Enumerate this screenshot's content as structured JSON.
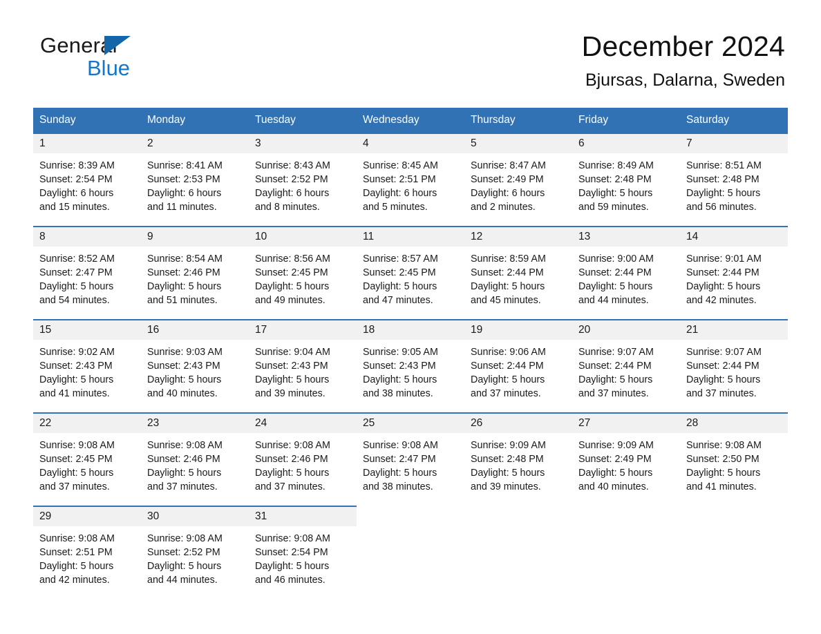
{
  "brand": {
    "line1": "General",
    "line2": "Blue",
    "triangle_icon": "triangle-icon",
    "color_black": "#1a1a1a",
    "color_blue": "#1577c7"
  },
  "header": {
    "title": "December 2024",
    "subtitle": "Bjursas, Dalarna, Sweden"
  },
  "theme": {
    "header_blue": "#3072b4",
    "daynum_gray": "#f1f1f1",
    "text": "#1a1a1a"
  },
  "weekday_headers": [
    "Sunday",
    "Monday",
    "Tuesday",
    "Wednesday",
    "Thursday",
    "Friday",
    "Saturday"
  ],
  "weeks": [
    [
      {
        "day": "1",
        "sunrise": "Sunrise: 8:39 AM",
        "sunset": "Sunset: 2:54 PM",
        "daylight1": "Daylight: 6 hours",
        "daylight2": "and 15 minutes."
      },
      {
        "day": "2",
        "sunrise": "Sunrise: 8:41 AM",
        "sunset": "Sunset: 2:53 PM",
        "daylight1": "Daylight: 6 hours",
        "daylight2": "and 11 minutes."
      },
      {
        "day": "3",
        "sunrise": "Sunrise: 8:43 AM",
        "sunset": "Sunset: 2:52 PM",
        "daylight1": "Daylight: 6 hours",
        "daylight2": "and 8 minutes."
      },
      {
        "day": "4",
        "sunrise": "Sunrise: 8:45 AM",
        "sunset": "Sunset: 2:51 PM",
        "daylight1": "Daylight: 6 hours",
        "daylight2": "and 5 minutes."
      },
      {
        "day": "5",
        "sunrise": "Sunrise: 8:47 AM",
        "sunset": "Sunset: 2:49 PM",
        "daylight1": "Daylight: 6 hours",
        "daylight2": "and 2 minutes."
      },
      {
        "day": "6",
        "sunrise": "Sunrise: 8:49 AM",
        "sunset": "Sunset: 2:48 PM",
        "daylight1": "Daylight: 5 hours",
        "daylight2": "and 59 minutes."
      },
      {
        "day": "7",
        "sunrise": "Sunrise: 8:51 AM",
        "sunset": "Sunset: 2:48 PM",
        "daylight1": "Daylight: 5 hours",
        "daylight2": "and 56 minutes."
      }
    ],
    [
      {
        "day": "8",
        "sunrise": "Sunrise: 8:52 AM",
        "sunset": "Sunset: 2:47 PM",
        "daylight1": "Daylight: 5 hours",
        "daylight2": "and 54 minutes."
      },
      {
        "day": "9",
        "sunrise": "Sunrise: 8:54 AM",
        "sunset": "Sunset: 2:46 PM",
        "daylight1": "Daylight: 5 hours",
        "daylight2": "and 51 minutes."
      },
      {
        "day": "10",
        "sunrise": "Sunrise: 8:56 AM",
        "sunset": "Sunset: 2:45 PM",
        "daylight1": "Daylight: 5 hours",
        "daylight2": "and 49 minutes."
      },
      {
        "day": "11",
        "sunrise": "Sunrise: 8:57 AM",
        "sunset": "Sunset: 2:45 PM",
        "daylight1": "Daylight: 5 hours",
        "daylight2": "and 47 minutes."
      },
      {
        "day": "12",
        "sunrise": "Sunrise: 8:59 AM",
        "sunset": "Sunset: 2:44 PM",
        "daylight1": "Daylight: 5 hours",
        "daylight2": "and 45 minutes."
      },
      {
        "day": "13",
        "sunrise": "Sunrise: 9:00 AM",
        "sunset": "Sunset: 2:44 PM",
        "daylight1": "Daylight: 5 hours",
        "daylight2": "and 44 minutes."
      },
      {
        "day": "14",
        "sunrise": "Sunrise: 9:01 AM",
        "sunset": "Sunset: 2:44 PM",
        "daylight1": "Daylight: 5 hours",
        "daylight2": "and 42 minutes."
      }
    ],
    [
      {
        "day": "15",
        "sunrise": "Sunrise: 9:02 AM",
        "sunset": "Sunset: 2:43 PM",
        "daylight1": "Daylight: 5 hours",
        "daylight2": "and 41 minutes."
      },
      {
        "day": "16",
        "sunrise": "Sunrise: 9:03 AM",
        "sunset": "Sunset: 2:43 PM",
        "daylight1": "Daylight: 5 hours",
        "daylight2": "and 40 minutes."
      },
      {
        "day": "17",
        "sunrise": "Sunrise: 9:04 AM",
        "sunset": "Sunset: 2:43 PM",
        "daylight1": "Daylight: 5 hours",
        "daylight2": "and 39 minutes."
      },
      {
        "day": "18",
        "sunrise": "Sunrise: 9:05 AM",
        "sunset": "Sunset: 2:43 PM",
        "daylight1": "Daylight: 5 hours",
        "daylight2": "and 38 minutes."
      },
      {
        "day": "19",
        "sunrise": "Sunrise: 9:06 AM",
        "sunset": "Sunset: 2:44 PM",
        "daylight1": "Daylight: 5 hours",
        "daylight2": "and 37 minutes."
      },
      {
        "day": "20",
        "sunrise": "Sunrise: 9:07 AM",
        "sunset": "Sunset: 2:44 PM",
        "daylight1": "Daylight: 5 hours",
        "daylight2": "and 37 minutes."
      },
      {
        "day": "21",
        "sunrise": "Sunrise: 9:07 AM",
        "sunset": "Sunset: 2:44 PM",
        "daylight1": "Daylight: 5 hours",
        "daylight2": "and 37 minutes."
      }
    ],
    [
      {
        "day": "22",
        "sunrise": "Sunrise: 9:08 AM",
        "sunset": "Sunset: 2:45 PM",
        "daylight1": "Daylight: 5 hours",
        "daylight2": "and 37 minutes."
      },
      {
        "day": "23",
        "sunrise": "Sunrise: 9:08 AM",
        "sunset": "Sunset: 2:46 PM",
        "daylight1": "Daylight: 5 hours",
        "daylight2": "and 37 minutes."
      },
      {
        "day": "24",
        "sunrise": "Sunrise: 9:08 AM",
        "sunset": "Sunset: 2:46 PM",
        "daylight1": "Daylight: 5 hours",
        "daylight2": "and 37 minutes."
      },
      {
        "day": "25",
        "sunrise": "Sunrise: 9:08 AM",
        "sunset": "Sunset: 2:47 PM",
        "daylight1": "Daylight: 5 hours",
        "daylight2": "and 38 minutes."
      },
      {
        "day": "26",
        "sunrise": "Sunrise: 9:09 AM",
        "sunset": "Sunset: 2:48 PM",
        "daylight1": "Daylight: 5 hours",
        "daylight2": "and 39 minutes."
      },
      {
        "day": "27",
        "sunrise": "Sunrise: 9:09 AM",
        "sunset": "Sunset: 2:49 PM",
        "daylight1": "Daylight: 5 hours",
        "daylight2": "and 40 minutes."
      },
      {
        "day": "28",
        "sunrise": "Sunrise: 9:08 AM",
        "sunset": "Sunset: 2:50 PM",
        "daylight1": "Daylight: 5 hours",
        "daylight2": "and 41 minutes."
      }
    ],
    [
      {
        "day": "29",
        "sunrise": "Sunrise: 9:08 AM",
        "sunset": "Sunset: 2:51 PM",
        "daylight1": "Daylight: 5 hours",
        "daylight2": "and 42 minutes."
      },
      {
        "day": "30",
        "sunrise": "Sunrise: 9:08 AM",
        "sunset": "Sunset: 2:52 PM",
        "daylight1": "Daylight: 5 hours",
        "daylight2": "and 44 minutes."
      },
      {
        "day": "31",
        "sunrise": "Sunrise: 9:08 AM",
        "sunset": "Sunset: 2:54 PM",
        "daylight1": "Daylight: 5 hours",
        "daylight2": "and 46 minutes."
      },
      {
        "day": "",
        "sunrise": "",
        "sunset": "",
        "daylight1": "",
        "daylight2": ""
      },
      {
        "day": "",
        "sunrise": "",
        "sunset": "",
        "daylight1": "",
        "daylight2": ""
      },
      {
        "day": "",
        "sunrise": "",
        "sunset": "",
        "daylight1": "",
        "daylight2": ""
      },
      {
        "day": "",
        "sunrise": "",
        "sunset": "",
        "daylight1": "",
        "daylight2": ""
      }
    ]
  ]
}
